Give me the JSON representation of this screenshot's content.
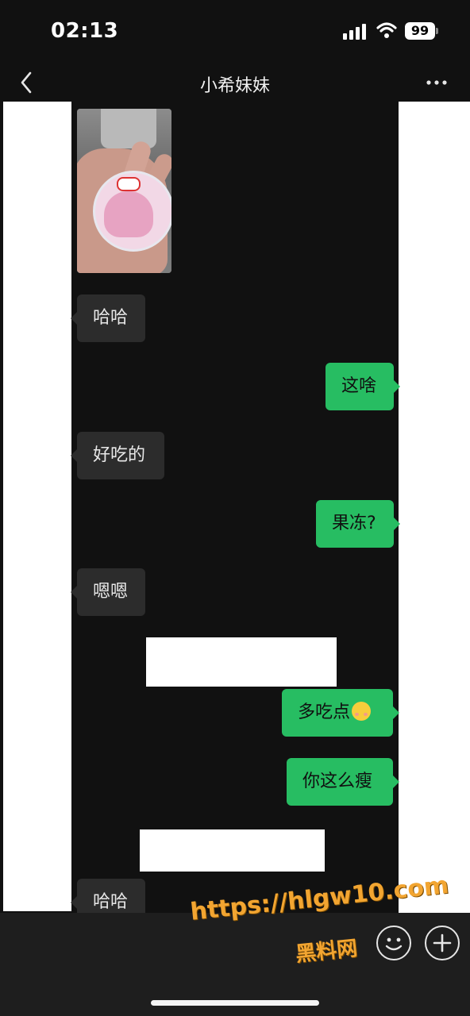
{
  "status": {
    "time": "02:13",
    "battery": "99"
  },
  "header": {
    "title": "小希妹妹"
  },
  "messages": [
    {
      "side": "in",
      "type": "image"
    },
    {
      "side": "in",
      "text": "哈哈"
    },
    {
      "side": "out",
      "text": "这啥"
    },
    {
      "side": "in",
      "text": "好吃的"
    },
    {
      "side": "out",
      "text": "果冻?"
    },
    {
      "side": "in",
      "text": "嗯嗯"
    },
    {
      "side": "out",
      "text": "多吃点"
    },
    {
      "side": "out",
      "text": "你这么瘦"
    },
    {
      "side": "in",
      "text": "哈哈"
    }
  ],
  "watermark": {
    "url": "https://hlgw10.com",
    "name": "黑料网"
  },
  "icons": [
    "back-chevron-icon",
    "more-dots-icon",
    "signal-icon",
    "wifi-icon",
    "battery-icon",
    "emoji-face-icon",
    "add-plus-icon",
    "smiling-emoji-icon"
  ],
  "colors": {
    "background": "#111111",
    "incoming_bubble": "#2c2c2c",
    "outgoing_bubble": "#27bd62",
    "watermark": "#f2a531"
  }
}
